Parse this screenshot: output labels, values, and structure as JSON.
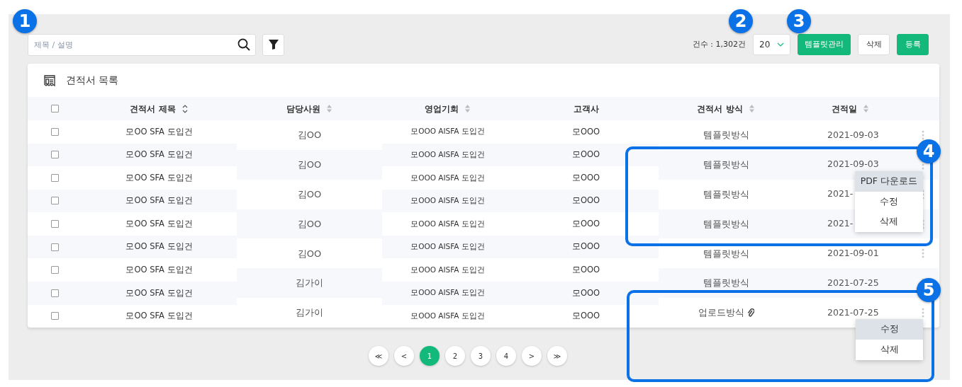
{
  "toolbar": {
    "search": {
      "placeholder": "제목 / 설명"
    },
    "count": "건수 : 1,302건",
    "page_size": "20",
    "buttons": [
      {
        "label": "템플릿관리",
        "kind": "primary"
      },
      {
        "label": "삭제",
        "kind": "plain"
      },
      {
        "label": "등록",
        "kind": "primary"
      }
    ]
  },
  "card": {
    "title": "견적서 목록"
  },
  "table": {
    "header_checked": false,
    "columns": [
      {
        "label": "견적서 제목",
        "sorted": true
      },
      {
        "label": "담당사원",
        "sorted": false
      },
      {
        "label": "영업기회",
        "sorted": false
      },
      {
        "label": "고객사"
      },
      {
        "label": "견적서 방식",
        "sorted": false
      },
      {
        "label": "견적일",
        "sorted": false
      }
    ],
    "rows": [
      {
        "checked": false,
        "title": "모OO SFA 도입건",
        "opportunity": "모OOO AISFA 도입건",
        "customer": "모OOO"
      },
      {
        "checked": false,
        "title": "모OO SFA 도입건",
        "opportunity": "모OOO AISFA 도입건",
        "customer": "모OOO"
      },
      {
        "checked": false,
        "title": "모OO SFA 도입건",
        "opportunity": "모OOO AISFA 도입건",
        "customer": "모OOO"
      },
      {
        "checked": false,
        "title": "모OO SFA 도입건",
        "opportunity": "모OOO AISFA 도입건",
        "customer": "모OOO"
      },
      {
        "checked": false,
        "title": "모OO SFA 도입건",
        "opportunity": "모OOO AISFA 도입건",
        "customer": "모OOO"
      },
      {
        "checked": false,
        "title": "모OO SFA 도입건",
        "opportunity": "모OOO AISFA 도입건",
        "customer": "모OOO"
      },
      {
        "checked": false,
        "title": "모OO SFA 도입건",
        "opportunity": "모OOO AISFA 도입건",
        "customer": "모OOO"
      },
      {
        "checked": false,
        "title": "모OO SFA 도입건",
        "opportunity": "모OOO AISFA 도입건",
        "customer": "모OOO"
      },
      {
        "checked": false,
        "title": "모OO SFA 도입건",
        "opportunity": "모OOO AISFA 도입건",
        "customer": "모OOO"
      }
    ],
    "records": [
      {
        "owner": "김OO",
        "method": "템플릿방식",
        "date": "2021-09-03"
      },
      {
        "owner": "김OO",
        "method": "템플릿방식",
        "date": "2021-09-03",
        "menu": [
          {
            "label": "PDF 다운로드",
            "selected": true
          },
          {
            "label": "수정",
            "selected": false
          },
          {
            "label": "삭제",
            "selected": false
          }
        ]
      },
      {
        "owner": "김OO",
        "method": "템플릿방식",
        "date": "2021-"
      },
      {
        "owner": "김OO",
        "method": "템플릿방식",
        "date": "2021-"
      },
      {
        "owner": "김OO",
        "method": "템플릿방식",
        "date": "2021-09-01"
      },
      {
        "owner": "김가이",
        "method": "템플릿방식",
        "date": "2021-07-25"
      },
      {
        "owner": "김가이",
        "method": "업로드방식",
        "attachment": true,
        "date": "2021-07-25",
        "menu": [
          {
            "label": "수정",
            "selected": true
          },
          {
            "label": "삭제",
            "selected": false
          }
        ]
      }
    ]
  },
  "pagination": [
    {
      "label": "≪",
      "selected": false
    },
    {
      "label": "<",
      "selected": false
    },
    {
      "label": "1",
      "selected": true
    },
    {
      "label": "2",
      "selected": false
    },
    {
      "label": "3",
      "selected": false
    },
    {
      "label": "4",
      "selected": false
    },
    {
      "label": ">",
      "selected": false
    },
    {
      "label": "≫",
      "selected": false
    }
  ],
  "annotations": [
    {
      "number": "1"
    },
    {
      "number": "2"
    },
    {
      "number": "3"
    },
    {
      "number": "4"
    },
    {
      "number": "5"
    }
  ]
}
